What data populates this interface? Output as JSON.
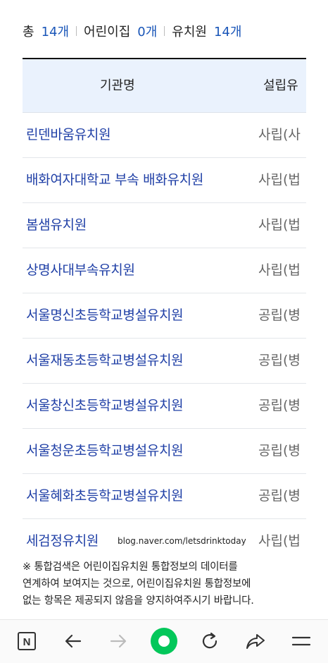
{
  "summary": {
    "total_label": "총",
    "total_count": "14개",
    "daycare_label": "어린이집",
    "daycare_count": "0개",
    "kinder_label": "유치원",
    "kinder_count": "14개"
  },
  "table": {
    "headers": [
      "기관명",
      "설립유"
    ],
    "rows": [
      {
        "name": "린덴바움유치원",
        "type": "사립(사"
      },
      {
        "name": "배화여자대학교 부속 배화유치원",
        "type": "사립(법"
      },
      {
        "name": "봄샘유치원",
        "type": "사립(법"
      },
      {
        "name": "상명사대부속유치원",
        "type": "사립(법"
      },
      {
        "name": "서울명신초등학교병설유치원",
        "type": "공립(병"
      },
      {
        "name": "서울재동초등학교병설유치원",
        "type": "공립(병"
      },
      {
        "name": "서울창신초등학교병설유치원",
        "type": "공립(병"
      },
      {
        "name": "서울청운초등학교병설유치원",
        "type": "공립(병"
      },
      {
        "name": "서울혜화초등학교병설유치원",
        "type": "공립(병"
      },
      {
        "name": "세검정유치원",
        "type": "사립(법"
      }
    ]
  },
  "watermark": "blog.naver.com/letsdrinktoday",
  "note": {
    "line1": "※ 통합검색은 어린이집유치원 통합정보의 데이터를",
    "line2": "연계하여 보여지는 것으로, 어린이집유치원 통합정보에",
    "line3": "없는 항목은 제공되지 않음을 양지하여주시기 바랍니다."
  },
  "navbar": {
    "icons": [
      "naver-n-icon",
      "back-arrow-icon",
      "forward-arrow-icon",
      "green-dot-icon",
      "refresh-icon",
      "share-icon",
      "menu-icon"
    ],
    "accent": "#03c75a",
    "n_letter": "N"
  }
}
